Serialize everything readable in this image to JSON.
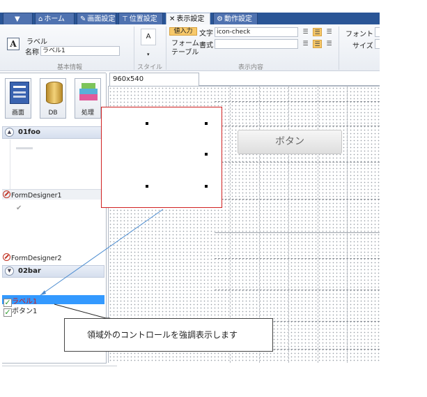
{
  "tabs": [
    {
      "label": "",
      "icon": "dropdown-arrow-icon"
    },
    {
      "label": "ホーム",
      "icon": "home-icon"
    },
    {
      "label": "画面設定",
      "icon": "tools-icon"
    },
    {
      "label": "位置設定",
      "icon": "position-icon"
    },
    {
      "label": "表示設定",
      "icon": "wrench-icon"
    },
    {
      "label": "動作設定",
      "icon": "action-icon"
    }
  ],
  "ribbon": {
    "basic": {
      "type_label": "ラベル",
      "name_label": "名称",
      "name_value": "ラベル1",
      "group_label": "基本情報"
    },
    "style": {
      "preview": "A",
      "group_label": "スタイル"
    },
    "display": {
      "value_input_label": "値入力",
      "text_label": "文字",
      "text_value": "icon-check",
      "form_label": "フォーム",
      "format_label": "書式",
      "format_value": "",
      "table_label": "テーブル",
      "group_label": "表示内容"
    },
    "font": {
      "font_label": "フォント",
      "size_label": "サイズ"
    }
  },
  "left_panel": {
    "big_buttons": [
      "画面",
      "DB",
      "処理"
    ],
    "section1": {
      "title": "01foo",
      "designer": "FormDesigner1"
    },
    "designer2": "FormDesigner2",
    "section2": {
      "title": "02bar"
    },
    "controls": [
      {
        "label": "ラベル1",
        "checked": true,
        "selected": true
      },
      {
        "label": "ボタン1",
        "checked": true,
        "selected": false
      }
    ]
  },
  "designer": {
    "tab_label": "960x540",
    "button_text": "ボタン"
  },
  "callout_text": "領域外のコントロールを強調表示します",
  "colors": {
    "tab_bar": "#2a5596",
    "highlight_box": "#d02020",
    "selection": "#3399ff",
    "accent": "#f7c96b"
  }
}
